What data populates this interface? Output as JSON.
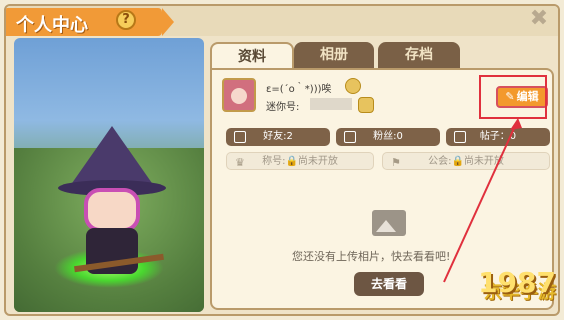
{
  "window": {
    "title": "个人中心",
    "help_icon": "?",
    "close_icon": "✖"
  },
  "tabs": [
    {
      "label": "资料"
    },
    {
      "label": "相册"
    },
    {
      "label": "存档"
    }
  ],
  "profile": {
    "nickname": "ε=(´ο｀*)))唉",
    "mini_id_label": "迷你号:",
    "edit_button_label": "编辑",
    "edit_button_icon": "✎"
  },
  "stats": {
    "friends": "好友:2",
    "fans": "粉丝:0",
    "posts": "帖子：0"
  },
  "locked": {
    "title_label": "称号:",
    "title_value": "尚未开放",
    "guild_label": "公会:",
    "guild_value": "尚未开放",
    "lock_glyph": "🔒"
  },
  "album": {
    "empty_message": "您还没有上传相片，快去看看吧!",
    "go_button_label": "去看看"
  },
  "watermark": {
    "number": "1987",
    "text": "京华手游"
  }
}
